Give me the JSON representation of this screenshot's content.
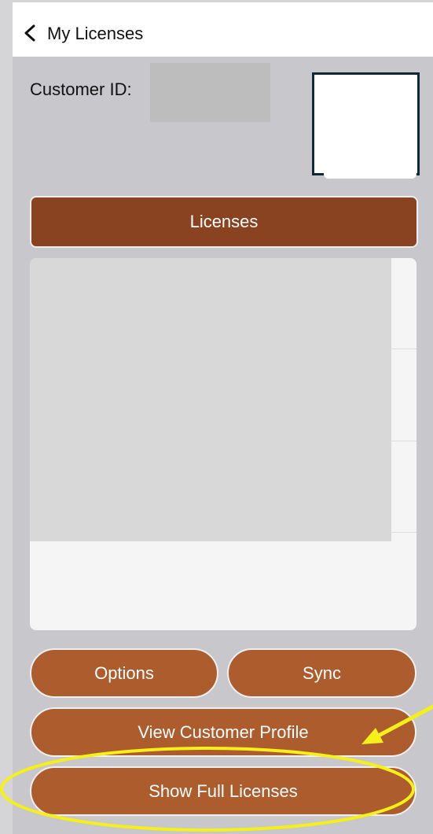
{
  "navbar": {
    "back_icon": "chevron-left-icon",
    "title": "My Licenses"
  },
  "customer": {
    "id_label": "Customer ID:",
    "id_value": ""
  },
  "licenses": {
    "header_label": "Licenses"
  },
  "buttons": {
    "options_label": "Options",
    "sync_label": "Sync",
    "profile_label": "View Customer Profile",
    "full_licenses_label": "Show Full Licenses"
  },
  "colors": {
    "header_brown": "#8a4320",
    "button_brown": "#ad5d2d",
    "annotation_yellow": "#f5ef1a",
    "background_gray": "#c7c7cc"
  }
}
